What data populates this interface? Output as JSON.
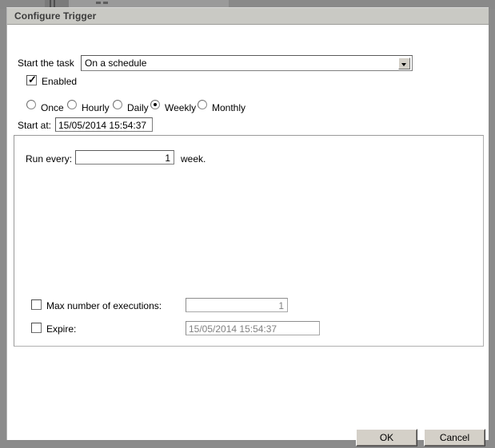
{
  "window": {
    "title": "Configure Trigger"
  },
  "form": {
    "start_task_label": "Start the task",
    "start_task_value": "On a schedule",
    "start_task_options": [
      "On a schedule"
    ],
    "enabled_label": "Enabled",
    "enabled_checked": "checked",
    "schedule_types": [
      {
        "label": "Once",
        "selected": false
      },
      {
        "label": "Hourly",
        "selected": false
      },
      {
        "label": "Daily",
        "selected": false
      },
      {
        "label": "Weekly",
        "selected": true
      },
      {
        "label": "Monthly",
        "selected": false
      }
    ],
    "start_at_label": "Start at:",
    "start_at_value": "15/05/2014 15:54:37"
  },
  "recurrence": {
    "run_every_label": "Run every:",
    "run_every_value": "1",
    "run_every_unit": "week.",
    "max_executions_label": "Max number of executions:",
    "max_executions_value": "1",
    "max_executions_checked": false,
    "expire_label": "Expire:",
    "expire_value": "15/05/2014 15:54:37",
    "expire_checked": false
  },
  "footer": {
    "ok_label": "OK",
    "cancel_label": "Cancel"
  },
  "colors": {
    "dialog_bg": "#ffffff",
    "titlebar_bg": "#c9c9c4",
    "desktop_bg": "#8b8b8b",
    "button_face": "#d4d0c8",
    "disabled_text": "#808080"
  }
}
